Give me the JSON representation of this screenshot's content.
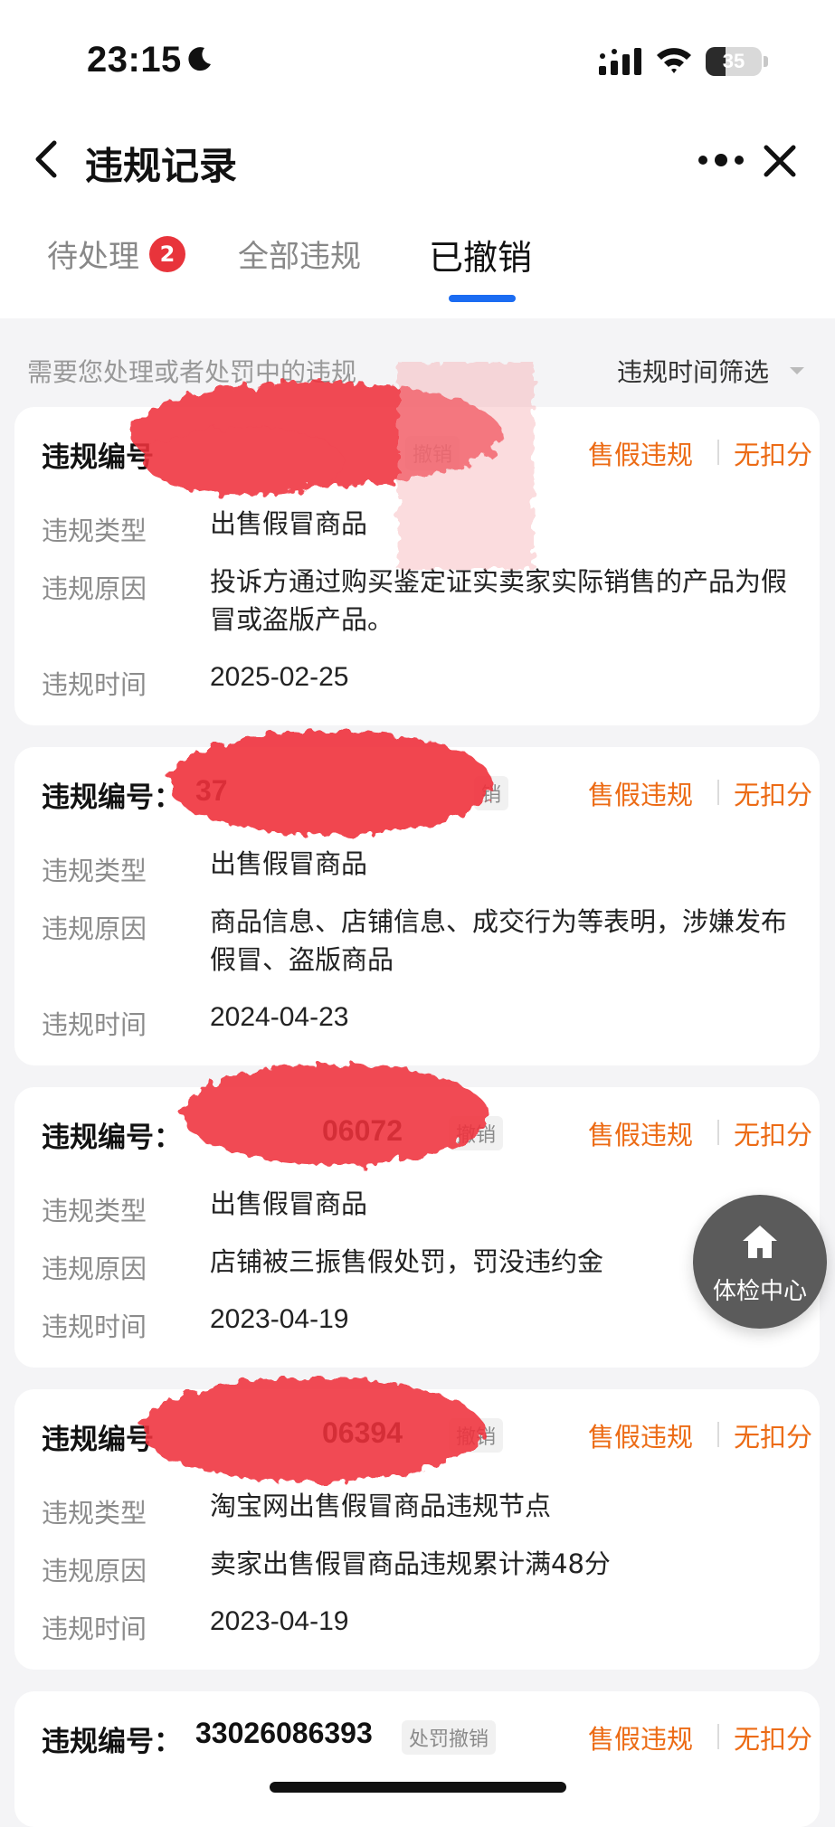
{
  "status_bar": {
    "time": "23:15",
    "battery_level": 35,
    "battery_text": "35"
  },
  "nav": {
    "title": "违规记录"
  },
  "tabs": [
    {
      "label": "待处理",
      "badge": "2",
      "active": false
    },
    {
      "label": "全部违规",
      "active": false
    },
    {
      "label": "已撤销",
      "active": true
    }
  ],
  "filter_row": {
    "hint": "需要您处理或者处罚中的违规",
    "filter_label": "违规时间筛选"
  },
  "labels": {
    "id": "违规编号",
    "id_colon": "违规编号：",
    "type": "违规类型",
    "reason": "违规原因",
    "time": "违规时间"
  },
  "records": [
    {
      "id_visible": "",
      "revoke_tag": "撤销",
      "tag_fake": "售假违规",
      "tag_points": "无扣分",
      "type": "出售假冒商品",
      "reason": "投诉方通过购买鉴定证实卖家实际销售的产品为假冒或盗版产品。",
      "time": "2025-02-25"
    },
    {
      "id_visible": "37",
      "revoke_tag": "销",
      "tag_fake": "售假违规",
      "tag_points": "无扣分",
      "type": "出售假冒商品",
      "reason": "商品信息、店铺信息、成交行为等表明，涉嫌发布假冒、盗版商品",
      "time": "2024-04-23"
    },
    {
      "id_visible": "06072",
      "revoke_tag": "撤销",
      "tag_fake": "售假违规",
      "tag_points": "无扣分",
      "type": "出售假冒商品",
      "reason": "店铺被三振售假处罚，罚没违约金",
      "time": "2023-04-19"
    },
    {
      "id_visible": "06394",
      "revoke_tag": "撤销",
      "tag_fake": "售假违规",
      "tag_points": "无扣分",
      "type": "淘宝网出售假冒商品违规节点",
      "reason": "卖家出售假冒商品违规累计满48分",
      "time": "2023-04-19"
    },
    {
      "id_visible": "33026086393",
      "revoke_tag": "处罚撤销",
      "tag_fake": "售假违规",
      "tag_points": "无扣分"
    }
  ],
  "fab": {
    "label": "体检中心",
    "icon": "home-icon"
  },
  "colors": {
    "accent_blue": "#1b6cf2",
    "tag_orange": "#ec6b15",
    "badge_red": "#e8343b",
    "redaction_red": "#f0303c"
  }
}
